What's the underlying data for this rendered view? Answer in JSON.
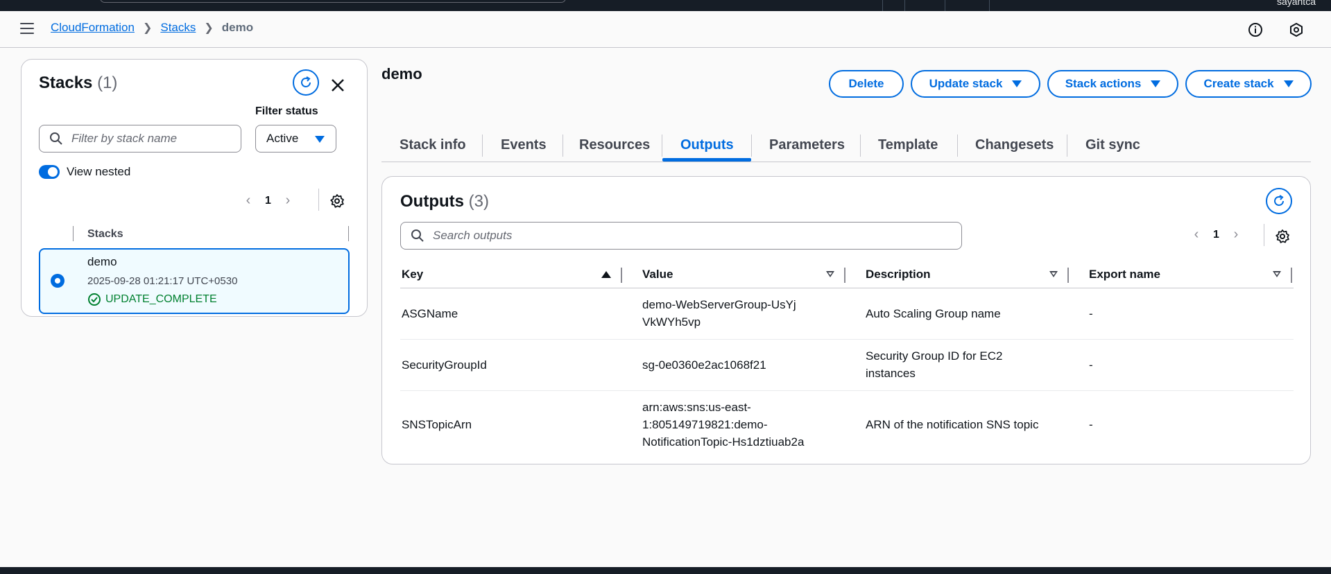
{
  "topbar": {
    "user": "sayantca"
  },
  "breadcrumb": {
    "items": [
      "CloudFormation",
      "Stacks"
    ],
    "current": "demo"
  },
  "stacks_panel": {
    "title": "Stacks",
    "count": "(1)",
    "filter_status_label": "Filter status",
    "filter_placeholder": "Filter by stack name",
    "filter_status_value": "Active",
    "view_nested_label": "View nested",
    "page": "1",
    "column_header": "Stacks",
    "stack": {
      "name": "demo",
      "date": "2025-09-28 01:21:17 UTC+0530",
      "status": "UPDATE_COMPLETE"
    }
  },
  "main": {
    "title": "demo",
    "buttons": {
      "delete": "Delete",
      "update_stack": "Update stack",
      "stack_actions": "Stack actions",
      "create_stack": "Create stack"
    },
    "tabs": [
      "Stack info",
      "Events",
      "Resources",
      "Outputs",
      "Parameters",
      "Template",
      "Changesets",
      "Git sync"
    ],
    "active_tab": "Outputs"
  },
  "outputs": {
    "title": "Outputs",
    "count": "(3)",
    "search_placeholder": "Search outputs",
    "page": "1",
    "columns": [
      "Key",
      "Value",
      "Description",
      "Export name"
    ],
    "rows": [
      {
        "key": "ASGName",
        "value": "demo-WebServerGroup-UsYjVkWYh5vp",
        "description": "Auto Scaling Group name",
        "export": "-"
      },
      {
        "key": "SecurityGroupId",
        "value": "sg-0e0360e2ac1068f21",
        "description": "Security Group ID for EC2 instances",
        "export": "-"
      },
      {
        "key": "SNSTopicArn",
        "value": "arn:aws:sns:us-east-1:805149719821:demo-NotificationTopic-Hs1dztiuab2a",
        "description": "ARN of the notification SNS topic",
        "export": "-"
      }
    ]
  },
  "colors": {
    "accent": "#006ce0",
    "success": "#00802f",
    "topbar": "#161d26"
  }
}
